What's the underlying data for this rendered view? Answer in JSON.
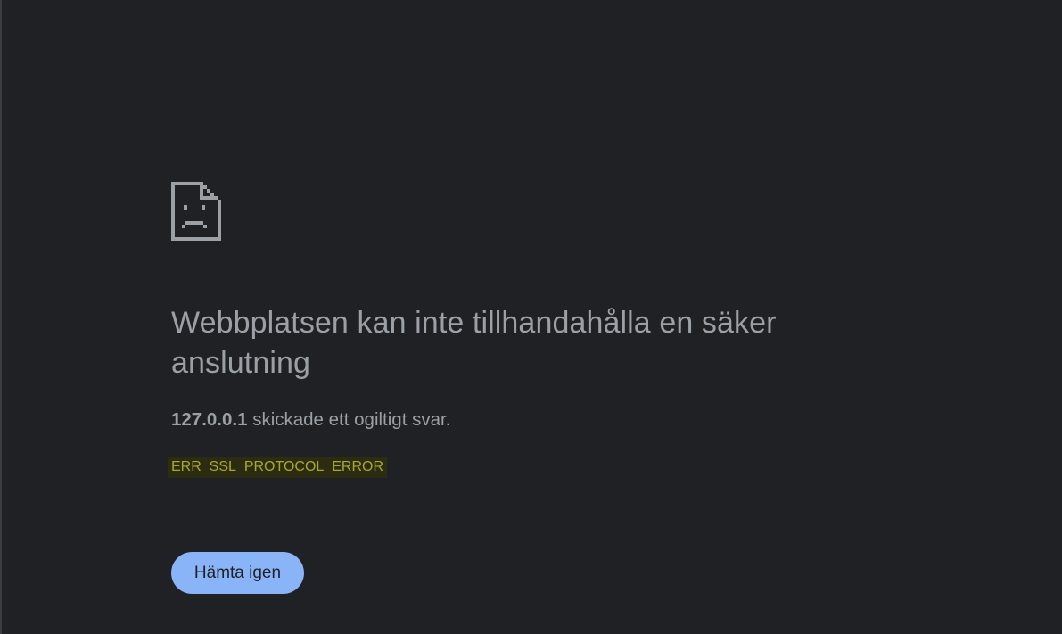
{
  "error_page": {
    "icon": "sad-document-icon",
    "heading": "Webbplatsen kan inte tillhandahålla en säker anslutning",
    "message": {
      "host": "127.0.0.1",
      "text": " skickade ett ogiltigt svar."
    },
    "error_code": "ERR_SSL_PROTOCOL_ERROR",
    "reload_button_label": "Hämta igen"
  },
  "colors": {
    "background": "#202124",
    "text": "#9aa0a6",
    "error_code_text": "#aaaa22",
    "error_code_highlight": "#2c2c12",
    "button": "#8ab4f8",
    "button_text": "#202124"
  }
}
